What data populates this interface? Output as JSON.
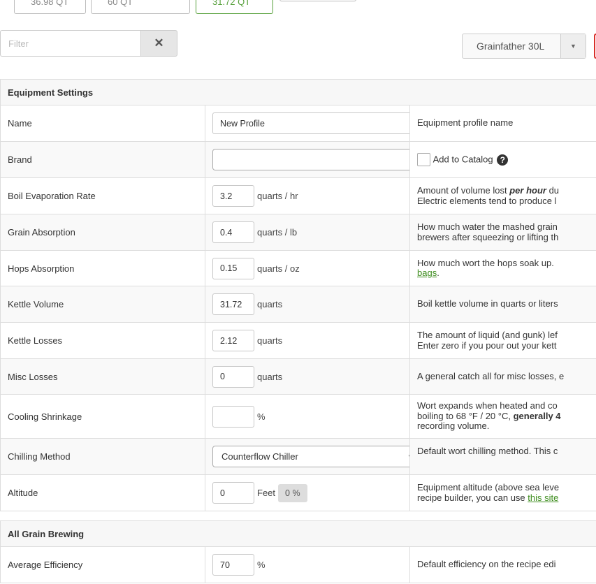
{
  "top_chips": [
    {
      "label": "36.98 QT"
    },
    {
      "label": "60 QT"
    },
    {
      "label": "31.72 QT"
    }
  ],
  "filter": {
    "placeholder": "Filter",
    "clear_symbol": "✕"
  },
  "profile_select": {
    "value": "Grainfather 30L",
    "arrow": "▼"
  },
  "equipment": {
    "heading": "Equipment Settings",
    "name": {
      "label": "Name",
      "value": "New Profile",
      "desc": "Equipment profile name"
    },
    "brand": {
      "label": "Brand",
      "value": "",
      "arrow": "▼",
      "catalog_label": "Add to Catalog",
      "help_symbol": "?"
    },
    "boil_evap": {
      "label": "Boil Evaporation Rate",
      "value": "3.2",
      "unit": "quarts / hr",
      "desc1_pre": "Amount of volume lost ",
      "desc1_em": "per hour",
      "desc1_post": " du",
      "desc2": "Electric elements tend to produce l"
    },
    "grain_abs": {
      "label": "Grain Absorption",
      "value": "0.4",
      "unit": "quarts / lb",
      "desc1": "How much water the mashed grain",
      "desc2": "brewers after squeezing or lifting th"
    },
    "hops_abs": {
      "label": "Hops Absorption",
      "value": "0.15",
      "unit": "quarts / oz",
      "desc1": "How much wort the hops soak up. ",
      "desc2_link": "bags",
      "desc2_post": "."
    },
    "kettle_vol": {
      "label": "Kettle Volume",
      "value": "31.72",
      "unit": "quarts",
      "desc": "Boil kettle volume in quarts or liters"
    },
    "kettle_loss": {
      "label": "Kettle Losses",
      "value": "2.12",
      "unit": "quarts",
      "desc1": "The amount of liquid (and gunk) lef",
      "desc2": "Enter zero if you pour out your kett"
    },
    "misc_loss": {
      "label": "Misc Losses",
      "value": "0",
      "unit": "quarts",
      "desc": "A general catch all for misc losses, e"
    },
    "cooling": {
      "label": "Cooling Shrinkage",
      "value": "",
      "unit": "%",
      "desc1": "Wort expands when heated and co",
      "desc2_pre": "boiling to 68 °F / 20 °C, ",
      "desc2_bold": "generally 4",
      "desc3": "recording volume."
    },
    "chilling": {
      "label": "Chilling Method",
      "value": "Counterflow Chiller",
      "arrow": "▼",
      "desc": "Default wort chilling method. This c"
    },
    "altitude": {
      "label": "Altitude",
      "value": "0",
      "unit": "Feet",
      "badge": "0 %",
      "desc1": "Equipment altitude (above sea leve",
      "desc2_pre": "recipe builder, you can use ",
      "desc2_link": "this site"
    }
  },
  "all_grain": {
    "heading": "All Grain Brewing",
    "efficiency": {
      "label": "Average Efficiency",
      "value": "70",
      "unit": "%",
      "desc": "Default efficiency on the recipe edi"
    }
  }
}
